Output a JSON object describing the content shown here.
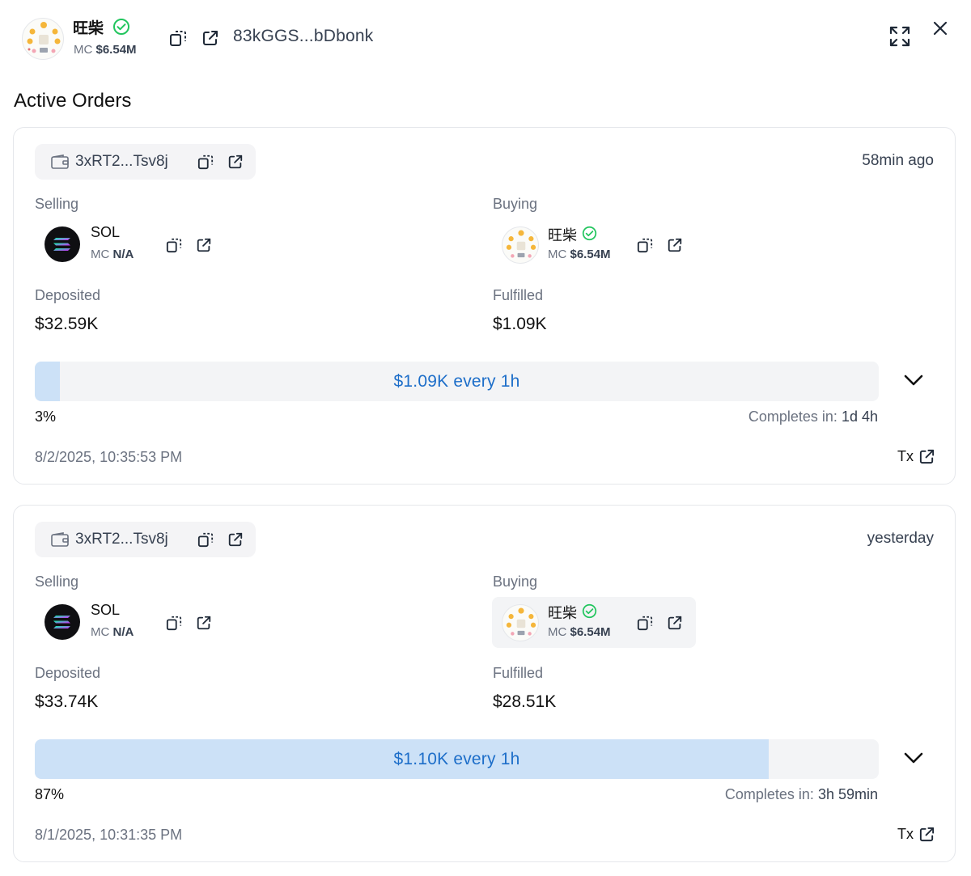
{
  "header": {
    "token_name": "旺柴",
    "mc_label": "MC",
    "mc_value": "$6.54M",
    "address": "83kGGS...bDbonk"
  },
  "section_title": "Active Orders",
  "orders": [
    {
      "wallet": "3xRT2...Tsv8j",
      "time_ago": "58min ago",
      "selling_label": "Selling",
      "selling": {
        "name": "SOL",
        "mc_label": "MC",
        "mc_value": "N/A"
      },
      "buying_label": "Buying",
      "buying": {
        "name": "旺柴",
        "mc_label": "MC",
        "mc_value": "$6.54M"
      },
      "deposited_label": "Deposited",
      "deposited": "$32.59K",
      "fulfilled_label": "Fulfilled",
      "fulfilled": "$1.09K",
      "progress_text": "$1.09K every 1h",
      "progress_fraction": 0.03,
      "percent": "3%",
      "completes_label": "Completes in:",
      "completes_value": "1d 4h",
      "date": "8/2/2025, 10:35:53 PM",
      "tx_label": "Tx"
    },
    {
      "wallet": "3xRT2...Tsv8j",
      "time_ago": "yesterday",
      "selling_label": "Selling",
      "selling": {
        "name": "SOL",
        "mc_label": "MC",
        "mc_value": "N/A"
      },
      "buying_label": "Buying",
      "buying": {
        "name": "旺柴",
        "mc_label": "MC",
        "mc_value": "$6.54M"
      },
      "deposited_label": "Deposited",
      "deposited": "$33.74K",
      "fulfilled_label": "Fulfilled",
      "fulfilled": "$28.51K",
      "progress_text": "$1.10K every 1h",
      "progress_fraction": 0.87,
      "percent": "87%",
      "completes_label": "Completes in:",
      "completes_value": "3h 59min",
      "date": "8/1/2025, 10:31:35 PM",
      "tx_label": "Tx"
    }
  ],
  "colors": {
    "accent_text": "#1d6ec9",
    "progress_fill": "#cce1f7",
    "verified": "#22c55e"
  },
  "icons": [
    "copy-icon",
    "external-link-icon",
    "wallet-icon",
    "verified-icon",
    "expand-icon",
    "close-icon",
    "chevron-down-icon",
    "solana-logo-icon"
  ]
}
